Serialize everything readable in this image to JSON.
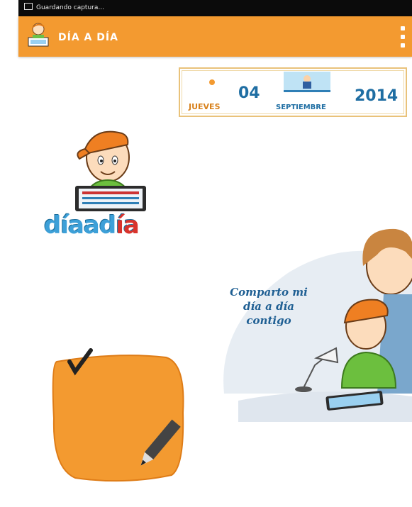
{
  "status_bar": {
    "text": "Guardando captura..."
  },
  "app_bar": {
    "title": "DÍA A DÍA"
  },
  "date_box": {
    "brand_small": "DIAADIA",
    "day_name": "JUEVES",
    "day_number": "04",
    "month": "SEPTIEMBRE",
    "year": "2014"
  },
  "brand": {
    "main": "díaad",
    "accent": "ía"
  },
  "slogan": {
    "line1": "Comparto mi",
    "line2": "día a día",
    "line3": "contigo"
  },
  "colors": {
    "accent": "#f39a30",
    "blue": "#1f6ea3",
    "orange_text": "#d8811c"
  }
}
